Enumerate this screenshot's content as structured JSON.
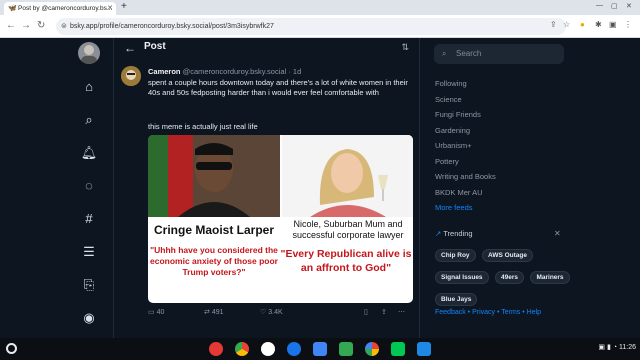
{
  "browser": {
    "tab_title": "Post by @cameroncorduroy.bs...",
    "url": "bsky.app/profile/cameroncorduroy.bsky.social/post/3m3isybrwfk27"
  },
  "header": {
    "title": "Post"
  },
  "post": {
    "display_name": "Cameron",
    "handle": "@cameroncorduroy.bsky.social",
    "age": "1d",
    "text": "spent a couple hours downtown today and there's a lot of white women in their 40s and 50s fedposting harder than i would ever feel comfortable with",
    "text2": "this meme is actually just real life",
    "meme": {
      "left_caption": "Cringe Maoist Larper",
      "left_quote": "\"Uhhh have you considered the economic anxiety of those poor Trump voters?\"",
      "right_caption": "Nicole, Suburban Mum and successful corporate lawyer",
      "right_quote": "\"Every Republican alive is an affront to God\""
    },
    "replies": "40",
    "reposts": "491",
    "likes": "3.4K"
  },
  "sidebar": {
    "search_placeholder": "Search",
    "feeds": [
      "Following",
      "Science",
      "Fungi Friends",
      "Gardening",
      "Urbanism+",
      "Pottery",
      "Writing and Books",
      "BKDK Mer AU"
    ],
    "more_feeds": "More feeds",
    "trending_label": "Trending",
    "trending": [
      "Chip Roy",
      "AWS Outage",
      "Signal Issues",
      "49ers",
      "Mariners",
      "Blue Jays"
    ],
    "footer": "Feedback • Privacy • Terms • Help"
  },
  "system": {
    "time": "11:26"
  },
  "colors": {
    "accent": "#1185fe",
    "bg": "#0d1520",
    "quote_red": "#c4161c"
  }
}
